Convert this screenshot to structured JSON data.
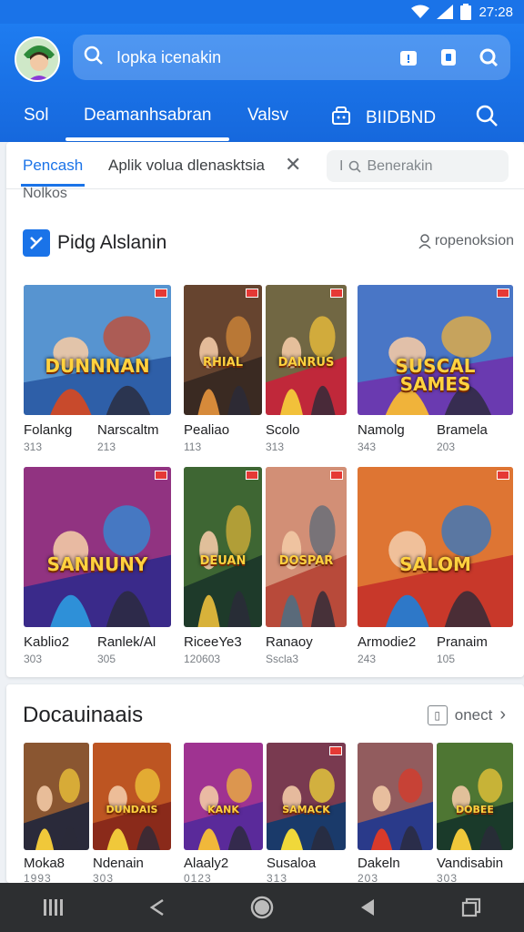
{
  "status": {
    "time": "27:28"
  },
  "header": {
    "search_text": "Iopka icenakin",
    "tabs": [
      "Sol",
      "Deamanhsabran",
      "Valsv",
      "BIIDBND"
    ]
  },
  "filters": {
    "active": "Pencash",
    "second": "Aplik volua dlenasktsia",
    "search_placeholder": "Benerakin"
  },
  "section1": {
    "small_label": "Nolkos",
    "title": "Pidg Alslanin",
    "action": "ropenoksion",
    "rows": [
      [
        {
          "name": "Folankg",
          "sub": "313",
          "art": "DUNNNAN",
          "palette": [
            "#2e5fa8",
            "#7ac0f0",
            "#c84a2c"
          ]
        },
        {
          "name": "Narscaltm",
          "sub": "213",
          "art": "",
          "palette": [
            "#2e5fa8",
            "#7ac0f0",
            "#c84a2c"
          ]
        },
        {
          "name": "Pealiao",
          "sub": "113",
          "art": "RHIAL",
          "palette": [
            "#3a2a22",
            "#8a5a3a",
            "#d68a3a"
          ]
        },
        {
          "name": "Scolo",
          "sub": "313",
          "art": "DANRUS",
          "palette": [
            "#c0283a",
            "#2f9a4a",
            "#f2c13a"
          ]
        },
        {
          "name": "Namolg",
          "sub": "343",
          "art": "SUSCAL SAMES",
          "palette": [
            "#6a3ab0",
            "#2ea8d8",
            "#f0b33a"
          ]
        },
        {
          "name": "Bramela",
          "sub": "203",
          "art": "",
          "palette": [
            "#6a3ab0",
            "#2ea8d8",
            "#f0b33a"
          ]
        }
      ],
      [
        {
          "name": "Kablio2",
          "sub": "303",
          "art": "SANNUNY",
          "palette": [
            "#3a2a8a",
            "#d83a7a",
            "#2e90d8"
          ]
        },
        {
          "name": "Ranlek/Al",
          "sub": "305",
          "art": "",
          "palette": [
            "#3a2a8a",
            "#d83a7a",
            "#2e90d8"
          ]
        },
        {
          "name": "RiceeYe3",
          "sub": "120603",
          "art": "DEUAN",
          "palette": [
            "#1e3a2a",
            "#5a8a3a",
            "#d8b23a"
          ]
        },
        {
          "name": "Ranaoy",
          "sub": "Sscla3",
          "art": "DOSPAR",
          "palette": [
            "#b84a3a",
            "#e8c8a8",
            "#5a6a7a"
          ]
        },
        {
          "name": "Armodie2",
          "sub": "243",
          "art": "SALOM",
          "palette": [
            "#c8382a",
            "#f0a83a",
            "#2e78c8"
          ]
        },
        {
          "name": "Pranaim",
          "sub": "105",
          "art": "",
          "palette": [
            "#c8382a",
            "#f0a83a",
            "#2e78c8"
          ]
        }
      ]
    ]
  },
  "section2": {
    "title": "Docauinaais",
    "action": "onect",
    "items": [
      {
        "name": "Moka8",
        "sub": "1993",
        "art": "",
        "palette": [
          "#2a2a3a",
          "#d87a2a",
          "#f0c83a"
        ]
      },
      {
        "name": "Ndenain",
        "sub": "303",
        "art": "DUNDAIS",
        "palette": [
          "#8a2a1a",
          "#e8782a",
          "#f0c83a"
        ]
      },
      {
        "name": "Alaaly2",
        "sub": "0123",
        "art": "KANK",
        "palette": [
          "#5a2a9a",
          "#d83a8a",
          "#f0b83a"
        ]
      },
      {
        "name": "Susaloa",
        "sub": "313",
        "art": "SAMACK",
        "palette": [
          "#1a3a6a",
          "#c83a3a",
          "#f0d83a"
        ]
      },
      {
        "name": "Dakeln",
        "sub": "203",
        "art": "",
        "palette": [
          "#2a3a8a",
          "#e8783a",
          "#d83a2a"
        ]
      },
      {
        "name": "Vandisabin",
        "sub": "303",
        "art": "DOBEE",
        "palette": [
          "#1a3a2a",
          "#7aa83a",
          "#f0c83a"
        ]
      }
    ]
  }
}
